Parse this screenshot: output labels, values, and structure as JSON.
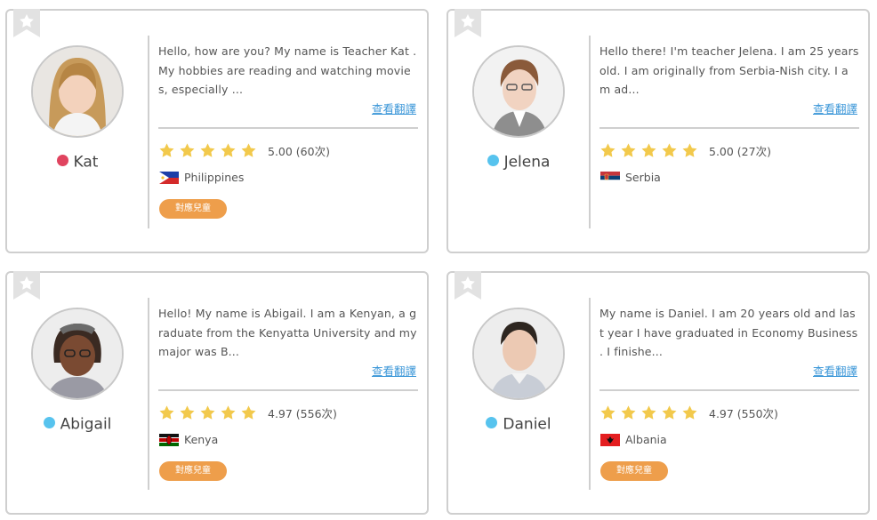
{
  "colors": {
    "border": "#cfcfcf",
    "star": "#f2c94c",
    "button": "#ee9e4b",
    "link": "#3a96d8",
    "status_red": "#e0445f",
    "status_blue": "#57c3ee"
  },
  "teachers": [
    {
      "name": "Kat",
      "status_color": "#e0445f",
      "bio": "Hello, how are you? My name is Teacher Kat . My hobbies are reading and watching movies, especially ...",
      "translate_label": "查看翻譯",
      "stars": 5,
      "rating": "5.00 (60次)",
      "country": "Philippines",
      "flag_icon": "philippines-flag-icon",
      "kids_label": "對應兒童"
    },
    {
      "name": "Jelena",
      "status_color": "#57c3ee",
      "bio": "Hello there! I'm teacher Jelena. I am 25 years old. I am originally from Serbia-Nish city. I am ad...",
      "translate_label": "查看翻譯",
      "stars": 5,
      "rating": "5.00 (27次)",
      "country": "Serbia",
      "flag_icon": "serbia-flag-icon",
      "kids_label": ""
    },
    {
      "name": "Abigail",
      "status_color": "#57c3ee",
      "bio": "Hello! My name is Abigail. I am a Kenyan, a graduate from the Kenyatta University and my major was B...",
      "translate_label": "查看翻譯",
      "stars": 5,
      "rating": "4.97 (556次)",
      "country": "Kenya",
      "flag_icon": "kenya-flag-icon",
      "kids_label": "對應兒童"
    },
    {
      "name": "Daniel",
      "status_color": "#57c3ee",
      "bio": "My name is Daniel. I am 20 years old and last year I have graduated in Economy Business . I finishe...",
      "translate_label": "查看翻譯",
      "stars": 5,
      "rating": "4.97 (550次)",
      "country": "Albania",
      "flag_icon": "albania-flag-icon",
      "kids_label": "對應兒童"
    }
  ]
}
